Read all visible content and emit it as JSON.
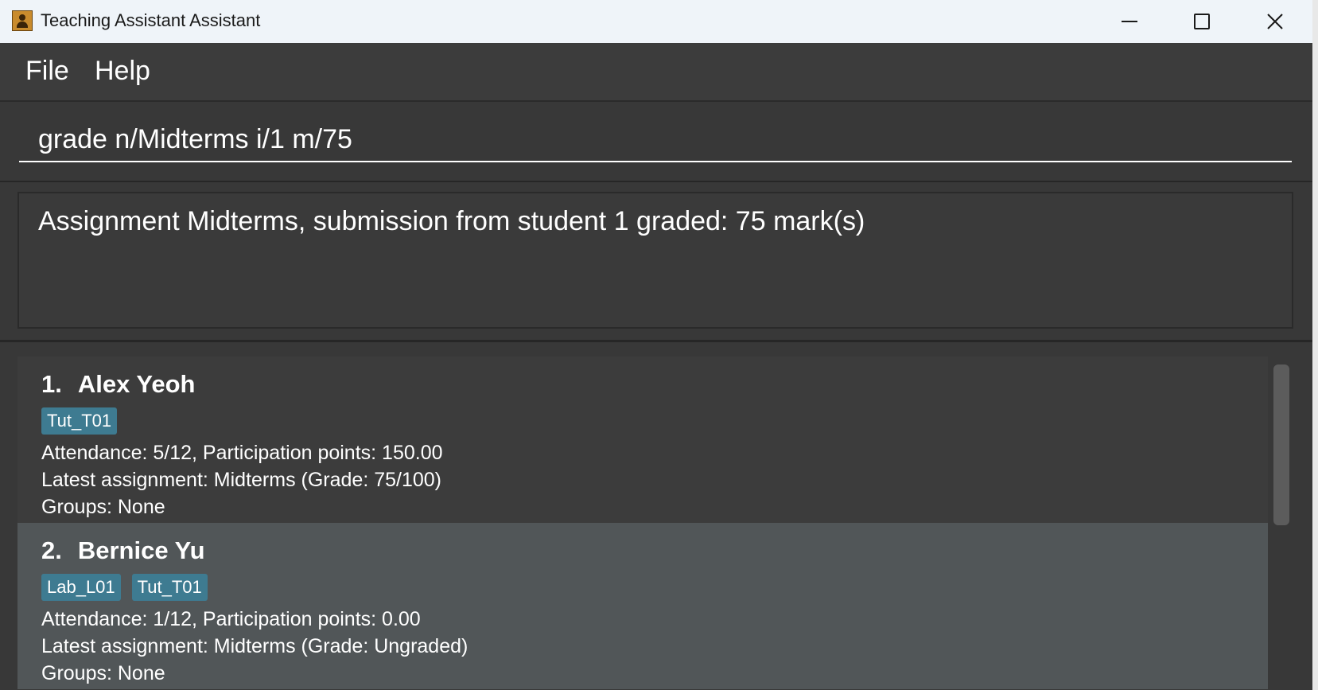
{
  "window": {
    "title": "Teaching Assistant Assistant",
    "icon": "addressbook-app-icon"
  },
  "menu": {
    "items": [
      {
        "label": "File"
      },
      {
        "label": "Help"
      }
    ]
  },
  "command": {
    "value": "grade n/Midterms i/1 m/75"
  },
  "result": {
    "text": "Assignment Midterms, submission from student 1 graded: 75 mark(s)"
  },
  "students": [
    {
      "index": "1.",
      "name": "Alex Yeoh",
      "tags": [
        "Tut_T01"
      ],
      "attendance": "Attendance: 5/12, Participation points: 150.00",
      "assignment": "Latest assignment: Midterms (Grade: 75/100)",
      "groups": "Groups: None"
    },
    {
      "index": "2.",
      "name": "Bernice Yu",
      "tags": [
        "Lab_L01",
        "Tut_T01"
      ],
      "attendance": "Attendance: 1/12, Participation points: 0.00",
      "assignment": "Latest assignment: Midterms (Grade: Ungraded)",
      "groups": "Groups: None"
    }
  ],
  "colors": {
    "background": "#383838",
    "selected_card": "#515658",
    "tag": "#3e7b91",
    "title_bar": "#eff4f9"
  }
}
